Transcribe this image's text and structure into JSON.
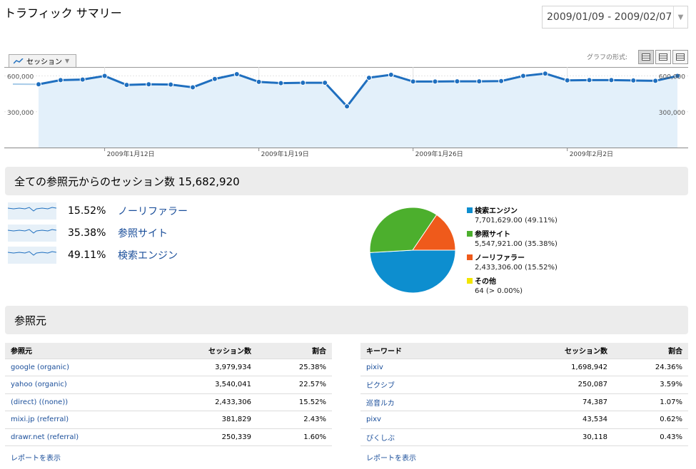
{
  "page_title": "トラフィック サマリー",
  "date_range": "2009/01/09 - 2009/02/07",
  "metric_selector": "セッション",
  "graph_mode_label": "グラフの形式:",
  "colors": {
    "line": "#1f6fbf",
    "fill": "#e3f0fa",
    "search": "#0d8ecf",
    "referral": "#4caf2d",
    "direct": "#ef5a1b",
    "other": "#f2e600"
  },
  "chart_data": {
    "type": "area",
    "ylabels": [
      "600,000",
      "300,000"
    ],
    "ylim": [
      0,
      620000
    ],
    "xticks": [
      "2009年1月12日",
      "2009年1月19日",
      "2009年1月26日",
      "2009年2月2日"
    ],
    "x": [
      "2009-01-09",
      "2009-01-10",
      "2009-01-11",
      "2009-01-12",
      "2009-01-13",
      "2009-01-14",
      "2009-01-15",
      "2009-01-16",
      "2009-01-17",
      "2009-01-18",
      "2009-01-19",
      "2009-01-20",
      "2009-01-21",
      "2009-01-22",
      "2009-01-23",
      "2009-01-24",
      "2009-01-25",
      "2009-01-26",
      "2009-01-27",
      "2009-01-28",
      "2009-01-29",
      "2009-01-30",
      "2009-01-31",
      "2009-02-01",
      "2009-02-02",
      "2009-02-03",
      "2009-02-04",
      "2009-02-05",
      "2009-02-06",
      "2009-02-07"
    ],
    "values": [
      530000,
      565000,
      570000,
      600000,
      525000,
      530000,
      528000,
      505000,
      575000,
      615000,
      550000,
      540000,
      543000,
      543000,
      345000,
      585000,
      610000,
      553000,
      553000,
      555000,
      555000,
      557000,
      600000,
      620000,
      563000,
      565000,
      565000,
      562000,
      559000,
      600000
    ]
  },
  "summary_title": "全ての参照元からのセッション数 15,682,920",
  "source_rows": [
    {
      "pct": "15.52%",
      "label": "ノーリファラー"
    },
    {
      "pct": "35.38%",
      "label": "参照サイト"
    },
    {
      "pct": "49.11%",
      "label": "検索エンジン"
    }
  ],
  "pie": [
    {
      "name": "検索エンジン",
      "value": "7,701,629.00 (49.11%)",
      "fraction": 0.4911,
      "color": "#0d8ecf"
    },
    {
      "name": "参照サイト",
      "value": "5,547,921.00 (35.38%)",
      "fraction": 0.3538,
      "color": "#4caf2d"
    },
    {
      "name": "ノーリファラー",
      "value": "2,433,306.00 (15.52%)",
      "fraction": 0.1552,
      "color": "#ef5a1b"
    },
    {
      "name": "その他",
      "value": "64 (> 0.00%)",
      "fraction": 0.0,
      "color": "#f2e600"
    }
  ],
  "sources_title": "参照元",
  "table_left": {
    "headers": [
      "参照元",
      "セッション数",
      "割合"
    ],
    "rows": [
      [
        "google (organic)",
        "3,979,934",
        "25.38%"
      ],
      [
        "yahoo (organic)",
        "3,540,041",
        "22.57%"
      ],
      [
        "(direct) ((none))",
        "2,433,306",
        "15.52%"
      ],
      [
        "mixi.jp (referral)",
        "381,829",
        "2.43%"
      ],
      [
        "drawr.net (referral)",
        "250,339",
        "1.60%"
      ]
    ],
    "report_link": "レポートを表示"
  },
  "table_right": {
    "headers": [
      "キーワード",
      "セッション数",
      "割合"
    ],
    "rows": [
      [
        "pixiv",
        "1,698,942",
        "24.36%"
      ],
      [
        "ピクシブ",
        "250,087",
        "3.59%"
      ],
      [
        "巡音ルカ",
        "74,387",
        "1.07%"
      ],
      [
        "pixv",
        "43,534",
        "0.62%"
      ],
      [
        "ぴくしぶ",
        "30,118",
        "0.43%"
      ]
    ],
    "report_link": "レポートを表示"
  }
}
